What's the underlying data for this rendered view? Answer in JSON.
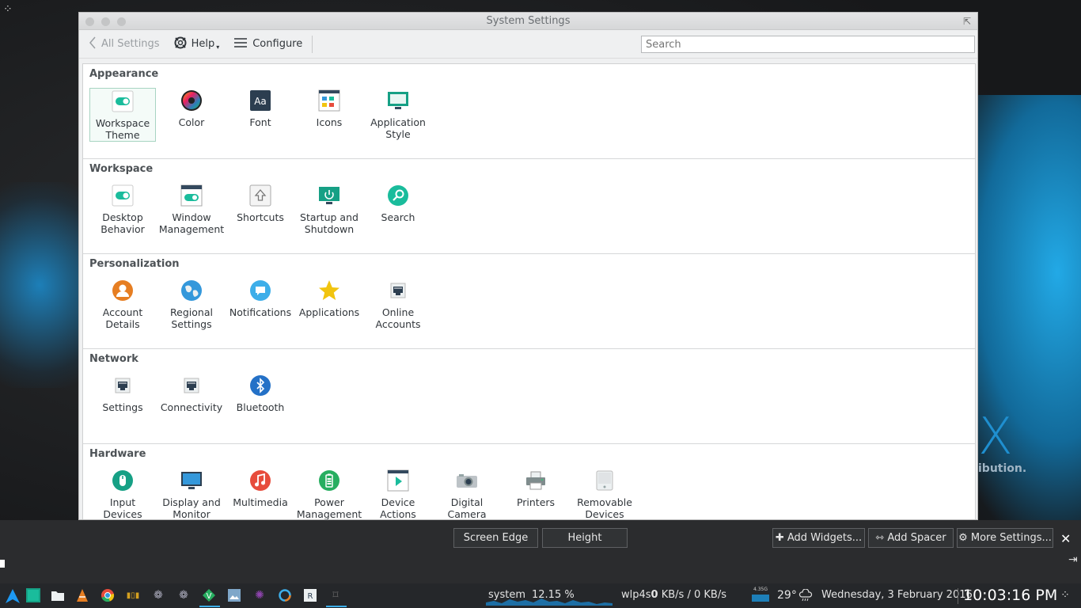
{
  "window": {
    "title": "System Settings"
  },
  "toolbar": {
    "back_label": "All Settings",
    "help_label": "Help",
    "configure_label": "Configure",
    "search_placeholder": "Search"
  },
  "sections": [
    {
      "title": "Appearance",
      "items": [
        {
          "label": "Workspace Theme",
          "icon": "toggle-icon"
        },
        {
          "label": "Color",
          "icon": "color-wheel-icon"
        },
        {
          "label": "Font",
          "icon": "font-icon"
        },
        {
          "label": "Icons",
          "icon": "icons-icon"
        },
        {
          "label": "Application Style",
          "icon": "monitor-icon"
        }
      ]
    },
    {
      "title": "Workspace",
      "items": [
        {
          "label": "Desktop Behavior",
          "icon": "toggle-icon"
        },
        {
          "label": "Window Management",
          "icon": "window-icon"
        },
        {
          "label": "Shortcuts",
          "icon": "keyboard-shortcut-icon"
        },
        {
          "label": "Startup and Shutdown",
          "icon": "startup-icon"
        },
        {
          "label": "Search",
          "icon": "search-icon"
        }
      ]
    },
    {
      "title": "Personalization",
      "items": [
        {
          "label": "Account Details",
          "icon": "user-icon"
        },
        {
          "label": "Regional Settings",
          "icon": "globe-icon"
        },
        {
          "label": "Notifications",
          "icon": "chat-bubble-icon"
        },
        {
          "label": "Applications",
          "icon": "star-icon"
        },
        {
          "label": "Online Accounts",
          "icon": "network-port-icon"
        }
      ]
    },
    {
      "title": "Network",
      "items": [
        {
          "label": "Settings",
          "icon": "network-port-icon"
        },
        {
          "label": "Connectivity",
          "icon": "network-port-icon"
        },
        {
          "label": "Bluetooth",
          "icon": "bluetooth-icon"
        }
      ]
    },
    {
      "title": "Hardware",
      "items": [
        {
          "label": "Input Devices",
          "icon": "mouse-icon"
        },
        {
          "label": "Display and Monitor",
          "icon": "display-icon"
        },
        {
          "label": "Multimedia",
          "icon": "music-icon"
        },
        {
          "label": "Power Management",
          "icon": "battery-icon"
        },
        {
          "label": "Device Actions",
          "icon": "play-icon"
        },
        {
          "label": "Digital Camera",
          "icon": "camera-icon"
        },
        {
          "label": "Printers",
          "icon": "printer-icon"
        },
        {
          "label": "Removable Devices",
          "icon": "drive-icon"
        }
      ]
    }
  ],
  "panel_edit": {
    "screen_edge": "Screen Edge",
    "height": "Height",
    "add_widgets": "Add Widgets...",
    "add_spacer": "Add Spacer",
    "more_settings": "More Settings..."
  },
  "taskbar": {
    "system_label": "system",
    "cpu_percent": "12.15 %",
    "net_iface": "wlp4s",
    "net_zero": "0",
    "net_rate": " KB/s / 0 KB/s",
    "disk_label": "4.35G",
    "temperature": "29°",
    "date": "Wednesday, 3 February 2016",
    "time": "10:03:16 PM"
  },
  "wallpaper": {
    "logo": "X",
    "tagline": "ibution."
  },
  "colors": {
    "accent": "#1d99f3",
    "teal": "#16a085",
    "panel": "#25272a"
  }
}
